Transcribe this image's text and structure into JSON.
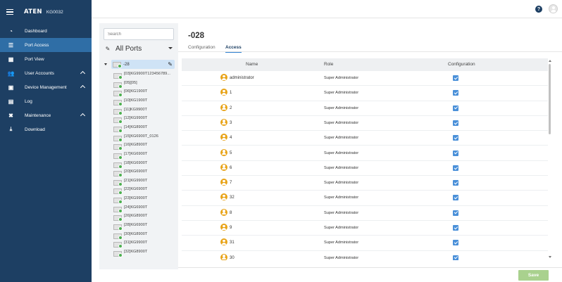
{
  "app": {
    "logo_text": "ATEN",
    "model": "KG0032"
  },
  "sidebar": {
    "items": [
      {
        "label": "Dashboard",
        "icon": "dashboard-icon",
        "active": false,
        "expandable": false
      },
      {
        "label": "Port Access",
        "icon": "list-icon",
        "active": true,
        "expandable": false
      },
      {
        "label": "Port View",
        "icon": "grid-icon",
        "active": false,
        "expandable": false
      },
      {
        "label": "User Accounts",
        "icon": "users-icon",
        "active": false,
        "expandable": true
      },
      {
        "label": "Device Management",
        "icon": "device-icon",
        "active": false,
        "expandable": true
      },
      {
        "label": "Log",
        "icon": "log-icon",
        "active": false,
        "expandable": false
      },
      {
        "label": "Maintenance",
        "icon": "tools-icon",
        "active": false,
        "expandable": true
      },
      {
        "label": "Download",
        "icon": "download-icon",
        "active": false,
        "expandable": false
      }
    ]
  },
  "topbar": {
    "help_icon": "?"
  },
  "tree_panel": {
    "search_placeholder": "Search",
    "filter_label": "All Ports",
    "root_label": "-28",
    "ports": [
      "[03]KG9900T123456789...",
      "[05][05]",
      "[06]KG1900T",
      "[10]KG1900T",
      "[11]KG9900T",
      "[12]KG9900T",
      "[14]KG8900T",
      "[15]KG6900T_0126",
      "[16]KG8900T",
      "[17]KG6900T",
      "[18]KG6900T",
      "[20]KG6900T",
      "[21]KG9900T",
      "[22]KG6900T",
      "[23]KG9900T",
      "[24]KG6900T",
      "[26]KG8900T",
      "[28]KG6900T",
      "[30]KG8900T",
      "[31]KG9900T",
      "[32]KG8900T"
    ]
  },
  "main": {
    "title": "-028",
    "tabs": [
      {
        "label": "Configuration",
        "active": false
      },
      {
        "label": "Access",
        "active": true
      }
    ],
    "table": {
      "headers": [
        "Name",
        "Role",
        "Configuration"
      ],
      "rows": [
        {
          "name": "administrator",
          "role": "Super Administrator",
          "configuration": true
        },
        {
          "name": "1",
          "role": "Super Administrator",
          "configuration": true
        },
        {
          "name": "2",
          "role": "Super Administrator",
          "configuration": true
        },
        {
          "name": "3",
          "role": "Super Administrator",
          "configuration": true
        },
        {
          "name": "4",
          "role": "Super Administrator",
          "configuration": true
        },
        {
          "name": "5",
          "role": "Super Administrator",
          "configuration": true
        },
        {
          "name": "6",
          "role": "Super Administrator",
          "configuration": true
        },
        {
          "name": "7",
          "role": "Super Administrator",
          "configuration": true
        },
        {
          "name": "32",
          "role": "Super Administrator",
          "configuration": true
        },
        {
          "name": "8",
          "role": "Super Administrator",
          "configuration": true
        },
        {
          "name": "9",
          "role": "Super Administrator",
          "configuration": true
        },
        {
          "name": "31",
          "role": "Super Administrator",
          "configuration": true
        },
        {
          "name": "30",
          "role": "Super Administrator",
          "configuration": true
        }
      ]
    },
    "save_label": "Save"
  },
  "colors": {
    "sidebar_bg": "#1d3f63",
    "sidebar_active": "#2f6ea6",
    "avatar": "#e8a317",
    "checkbox": "#4a90d9",
    "save_button": "#a9d18e"
  }
}
